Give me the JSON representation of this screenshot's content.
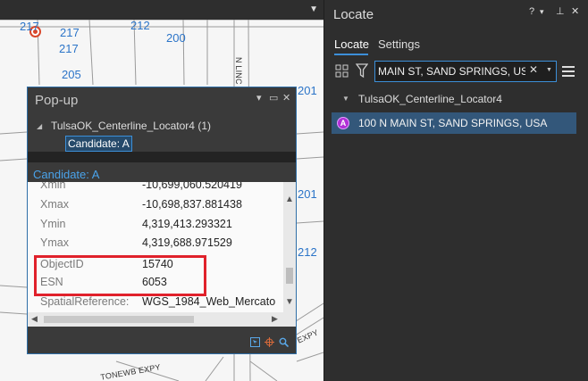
{
  "map": {
    "parcel_numbers": [
      "217",
      "217",
      "212",
      "200",
      "217",
      "205",
      "201",
      "201",
      "212"
    ],
    "street_labels": [
      "N LINC",
      "EXPY",
      "TONEWB EXPY"
    ]
  },
  "popup": {
    "title": "Pop-up",
    "controls": {
      "menu": "▾",
      "dock": "▭",
      "close": "✕"
    },
    "tree": {
      "layer": "TulsaOK_Centerline_Locator4",
      "count": "(1)",
      "candidate": "Candidate: A"
    },
    "header": "Candidate: A",
    "rows": [
      {
        "key": "Xmin",
        "value": "-10,699,060.520419"
      },
      {
        "key": "Xmax",
        "value": "-10,698,837.881438"
      },
      {
        "key": "Ymin",
        "value": "4,319,413.293321"
      },
      {
        "key": "Ymax",
        "value": "4,319,688.971529"
      },
      {
        "key": "ObjectID",
        "value": "15740"
      },
      {
        "key": "ESN",
        "value": "6053"
      },
      {
        "key": "SpatialReference:",
        "value": "WGS_1984_Web_Mercato"
      }
    ],
    "highlight_color": "#e0212b"
  },
  "locate": {
    "title": "Locate",
    "controls": {
      "help": "?",
      "menu": "▾",
      "pin": "⊥",
      "close": "✕"
    },
    "tabs": {
      "locate": "Locate",
      "settings": "Settings"
    },
    "search": {
      "value": "MAIN ST, SAND SPRINGS, USA",
      "clear": "✕",
      "dropdown": "▼"
    },
    "locator": {
      "arrow": "▼",
      "name": "TulsaOK_Centerline_Locator4"
    },
    "result": {
      "badge": "A",
      "text": "100 N MAIN ST, SAND SPRINGS, USA"
    },
    "accent_color": "#3c8fd8",
    "selection_color": "#33577a"
  },
  "icons": [
    "location-marker-icon",
    "grid-icon",
    "filter-icon",
    "menu-icon",
    "clear-icon",
    "dropdown-icon",
    "expand-arrow-icon"
  ]
}
